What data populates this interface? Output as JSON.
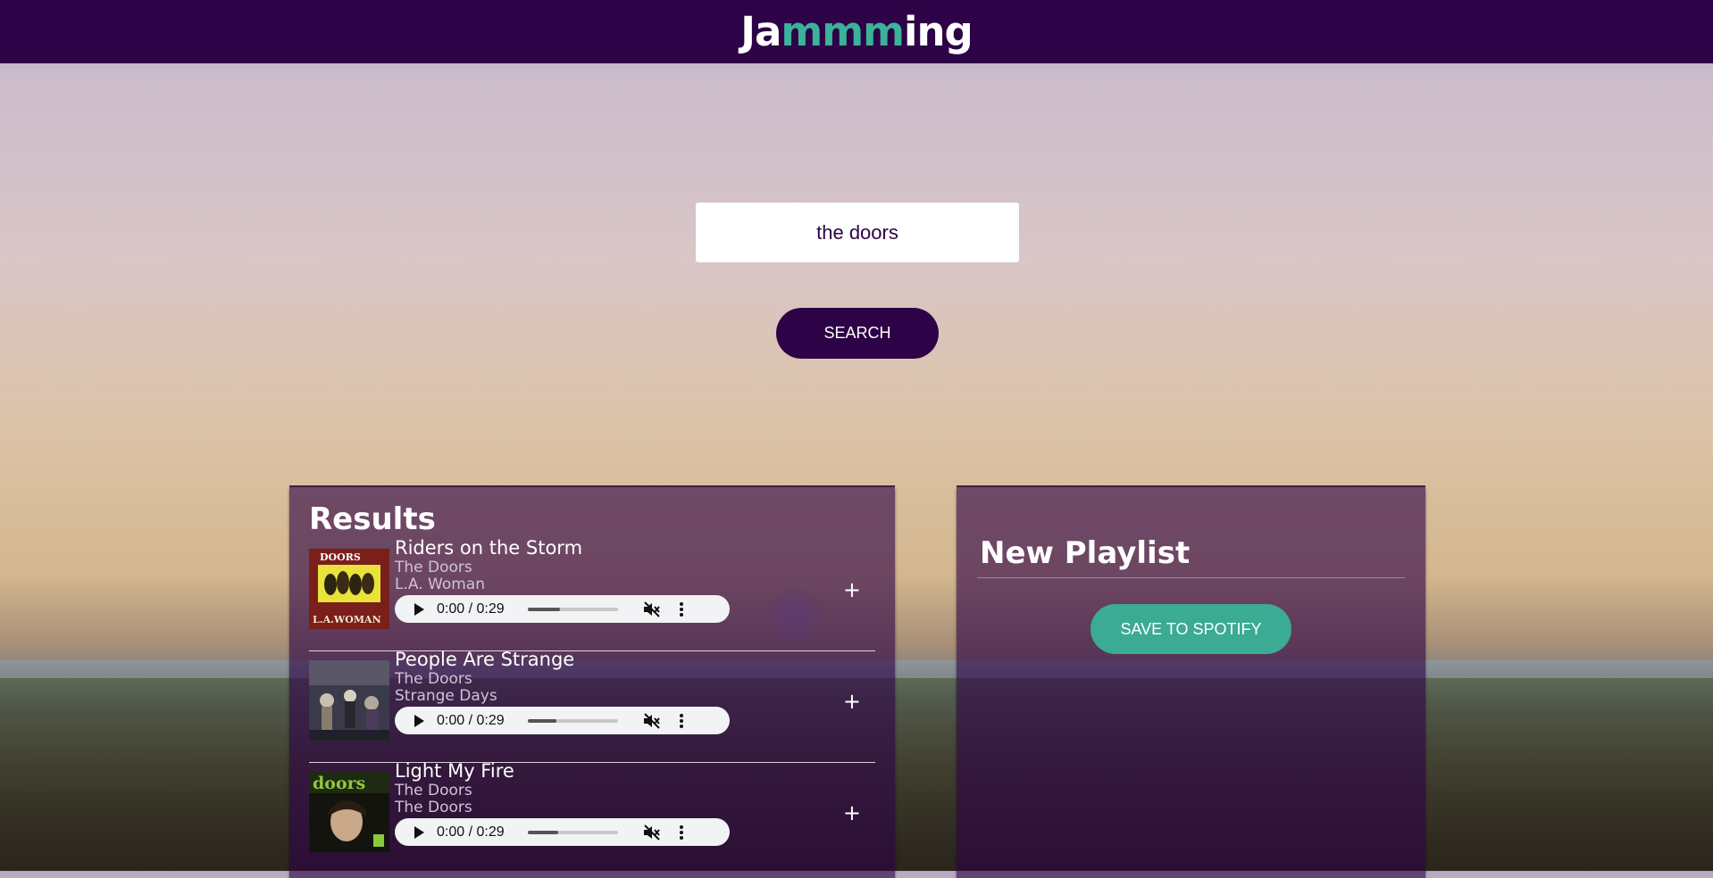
{
  "header": {
    "logo_part1": "Ja",
    "logo_highlight": "mmm",
    "logo_part2": "ing"
  },
  "search": {
    "value": "the doors",
    "button_label": "SEARCH"
  },
  "results": {
    "title": "Results",
    "tracks": [
      {
        "name": "Riders on the Storm",
        "artist": "The Doors",
        "album": "L.A. Woman",
        "time": "0:00 / 0:29",
        "add_label": "+"
      },
      {
        "name": "People Are Strange",
        "artist": "The Doors",
        "album": "Strange Days",
        "time": "0:00 / 0:29",
        "add_label": "+"
      },
      {
        "name": "Light My Fire",
        "artist": "The Doors",
        "album": "The Doors",
        "time": "0:00 / 0:29",
        "add_label": "+"
      }
    ]
  },
  "playlist": {
    "title": "New Playlist",
    "save_label": "SAVE TO SPOTIFY"
  },
  "colors": {
    "header_bg": "#2d0246",
    "accent": "#3bb29a",
    "save_button": "#3bab93"
  },
  "covers": [
    {
      "band_text": "DOORS",
      "album_text": "L.A.WOMAN"
    },
    {
      "band_text": "",
      "album_text": ""
    },
    {
      "band_text": "doors",
      "album_text": ""
    }
  ]
}
